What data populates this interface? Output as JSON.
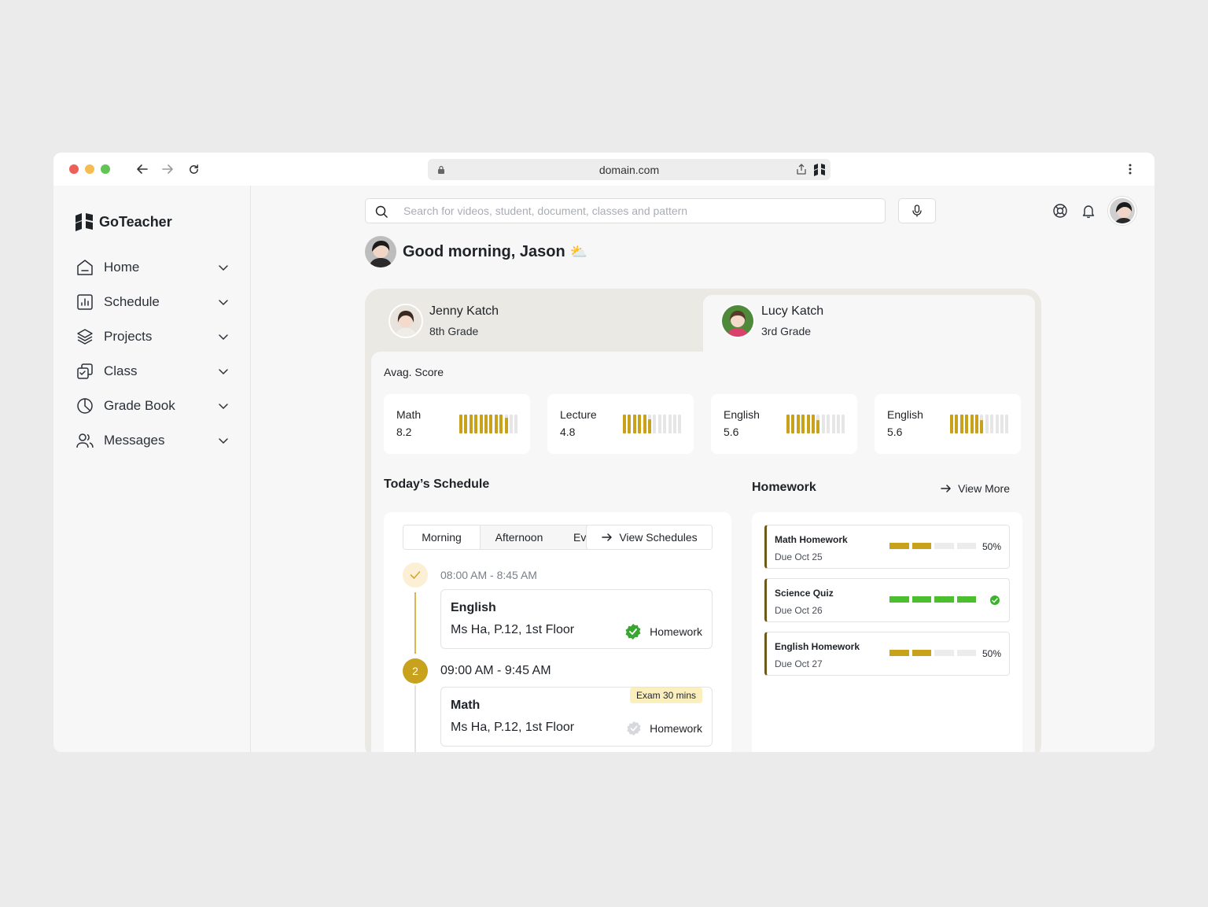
{
  "browser": {
    "url": "domain.com",
    "traffic_light_colors": [
      "#ee5f57",
      "#f5bd4f",
      "#61c454"
    ]
  },
  "app": {
    "name": "GoTeacher",
    "accent": "#c9a21d"
  },
  "sidebar": {
    "items": [
      {
        "label": "Home",
        "icon": "home-icon"
      },
      {
        "label": "Schedule",
        "icon": "chart-icon"
      },
      {
        "label": "Projects",
        "icon": "layers-icon"
      },
      {
        "label": "Class",
        "icon": "class-icon"
      },
      {
        "label": "Grade Book",
        "icon": "pie-icon"
      },
      {
        "label": "Messages",
        "icon": "users-icon"
      }
    ]
  },
  "header": {
    "search_placeholder": "Search for videos, student, document, classes and pattern"
  },
  "greeting": {
    "text": "Good morning, Jason",
    "emoji": "⛅"
  },
  "students": [
    {
      "name": "Jenny Katch",
      "grade": "8th Grade",
      "active": false
    },
    {
      "name": "Lucy Katch",
      "grade": "3rd Grade",
      "active": true
    }
  ],
  "avg_score": {
    "title": "Avag. Score",
    "cards": [
      {
        "subject": "Math",
        "value": "8.2",
        "level": 0.82
      },
      {
        "subject": "Lecture",
        "value": "4.8",
        "level": 0.48
      },
      {
        "subject": "English",
        "value": "5.6",
        "level": 0.56
      },
      {
        "subject": "English",
        "value": "5.6",
        "level": 0.56
      }
    ]
  },
  "schedule": {
    "title": "Today’s Schedule",
    "tabs": [
      "Morning",
      "Afternoon",
      "Ev"
    ],
    "view_label": "View Schedules",
    "slots": [
      {
        "time": "08:00 AM - 8:45 AM",
        "subject": "English",
        "location": "Ms Ha, P.12, 1st Floor",
        "homework": "Homework",
        "done": true,
        "tag": ""
      },
      {
        "step": "2",
        "time": "09:00 AM - 9:45 AM",
        "subject": "Math",
        "location": "Ms Ha, P.12, 1st Floor",
        "homework": "Homework",
        "done": false,
        "tag": "Exam 30 mins"
      }
    ]
  },
  "homework": {
    "title": "Homework",
    "view_more": "View More",
    "items": [
      {
        "name": "Math Homework",
        "due": "Due Oct 25",
        "progress": 0.5,
        "percent": "50%",
        "complete": false
      },
      {
        "name": "Science Quiz",
        "due": "Due Oct 26",
        "progress": 1.0,
        "percent": "",
        "complete": true
      },
      {
        "name": "English Homework",
        "due": "Due Oct 27",
        "progress": 0.5,
        "percent": "50%",
        "complete": false
      }
    ]
  }
}
